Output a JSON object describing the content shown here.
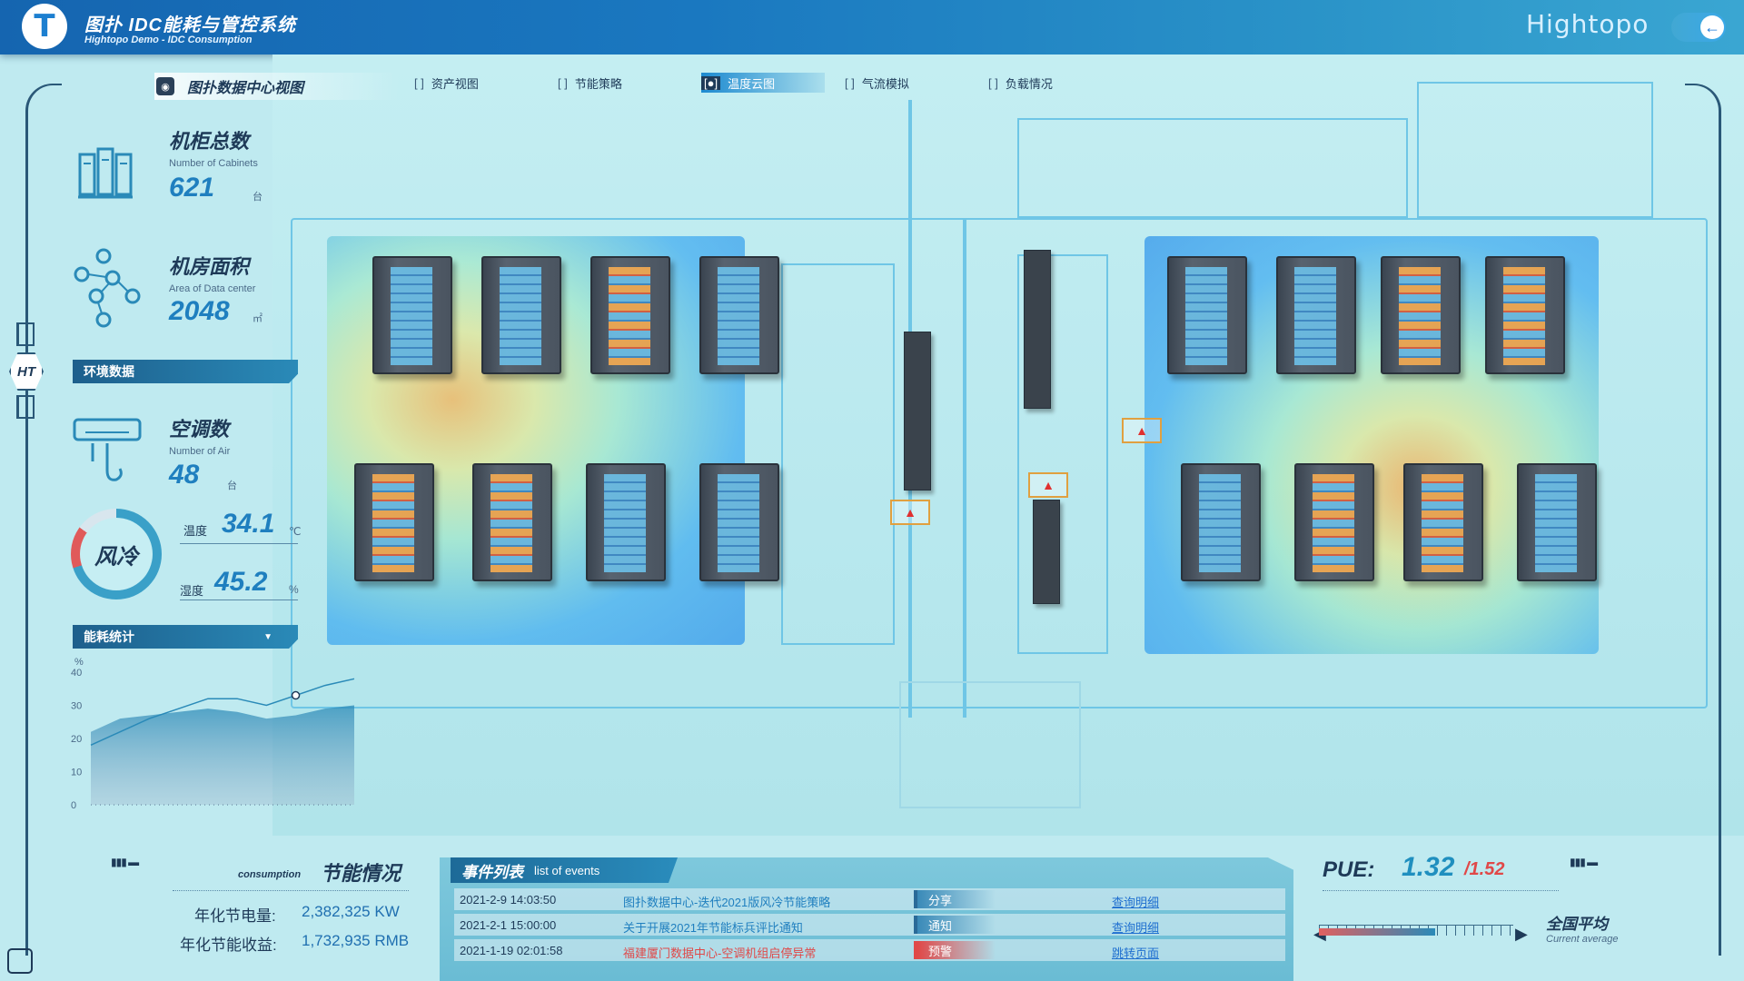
{
  "header": {
    "logo_letter": "T",
    "title": "图扑 IDC能耗与管控系统",
    "subtitle": "Hightopo Demo - IDC Consumption",
    "brand": "Hightopo",
    "back_icon": "arrow-left-icon"
  },
  "nav": {
    "view_title": "图扑数据中心视图",
    "tabs": [
      {
        "label": "资产视图",
        "active": false
      },
      {
        "label": "节能策略",
        "active": false
      },
      {
        "label": "温度云图",
        "active": true
      },
      {
        "label": "气流模拟",
        "active": false
      },
      {
        "label": "负载情况",
        "active": false
      }
    ]
  },
  "side": {
    "badge": "HT"
  },
  "stats": {
    "cabinets": {
      "title": "机柜总数",
      "en": "Number of Cabinets",
      "value": "621",
      "unit": "台"
    },
    "area": {
      "title": "机房面积",
      "en": "Area of Data center",
      "value": "2048",
      "unit": "㎡"
    },
    "air": {
      "title": "空调数",
      "en": "Number of Air",
      "value": "48",
      "unit": "台"
    }
  },
  "sections": {
    "env": "环境数据",
    "energy": "能耗统计"
  },
  "env": {
    "mode": "风冷",
    "temp_label": "温度",
    "temp_value": "34.1",
    "temp_unit": "℃",
    "hum_label": "湿度",
    "hum_value": "45.2",
    "hum_unit": "%"
  },
  "chart_data": {
    "type": "area",
    "ylabel": "%",
    "ylim": [
      0,
      40
    ],
    "yticks": [
      "40",
      "30",
      "20",
      "10",
      "0"
    ],
    "series": [
      {
        "values": [
          22,
          26,
          27,
          28,
          29,
          28,
          26,
          27,
          29,
          30
        ]
      },
      {
        "values": [
          18,
          22,
          26,
          29,
          32,
          32,
          30,
          33,
          36,
          38
        ]
      }
    ]
  },
  "savings": {
    "en": "consumption",
    "title": "节能情况",
    "power_label": "年化节电量:",
    "power_value": "2,382,325 KW",
    "income_label": "年化节能收益:",
    "income_value": "1,732,935 RMB"
  },
  "events": {
    "title_zh": "事件列表",
    "title_en": "list of events",
    "rows": [
      {
        "date": "2021-2-9 14:03:50",
        "text": "图扑数据中心-迭代2021版风冷节能策略",
        "tag": "分享",
        "link": "查询明细",
        "kind": "share"
      },
      {
        "date": "2021-2-1 15:00:00",
        "text": "关于开展2021年节能标兵评比通知",
        "tag": "通知",
        "link": "查询明细",
        "kind": "notify"
      },
      {
        "date": "2021-1-19 02:01:58",
        "text": "福建厦门数据中心-空调机组启停异常",
        "tag": "预警",
        "link": "跳转页面",
        "kind": "warn"
      }
    ]
  },
  "pue": {
    "label": "PUE:",
    "value": "1.32",
    "ref": "/1.52",
    "progress": 0.6,
    "avg_label": "全国平均",
    "avg_en": "Current average"
  },
  "colors": {
    "accent": "#1f7fbf",
    "warn": "#e04848",
    "header": "#1565b0"
  }
}
